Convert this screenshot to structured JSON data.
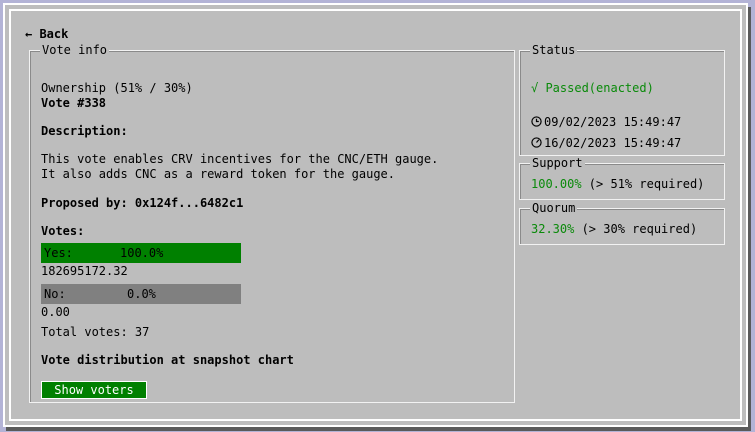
{
  "nav": {
    "back_label": "← Back"
  },
  "vote_info": {
    "legend": "Vote info",
    "ownership": "Ownership (51% / 30%)",
    "vote_number": "Vote #338",
    "description_heading": "Description:",
    "description_lines": [
      "This vote enables CRV incentives for the CNC/ETH gauge.",
      "It also adds CNC as a reward token for the gauge."
    ],
    "proposed_by": "Proposed by: 0x124f...6482c1",
    "votes_heading": "Votes:",
    "yes": {
      "label": "Yes:",
      "percent_text": "100.0%",
      "fill": 1.0,
      "amount": "182695172.32"
    },
    "no": {
      "label": "No:",
      "percent_text": "0.0%",
      "fill": 0.0,
      "amount": "0.00"
    },
    "total_votes": "Total votes: 37",
    "distribution_heading": "Vote distribution at snapshot chart",
    "show_voters_label": "Show voters"
  },
  "status": {
    "legend": "Status",
    "state": "√ Passed(enacted)",
    "start_time": "09/02/2023 15:49:47",
    "end_time": "16/02/2023 15:49:47",
    "start_icon": "clock-icon",
    "end_icon": "clock-end-icon"
  },
  "support": {
    "legend": "Support",
    "value": "100.00%",
    "requirement": " (> 51% required)"
  },
  "quorum": {
    "legend": "Quorum",
    "value": "32.30%",
    "requirement": " (> 30% required)"
  },
  "colors": {
    "accent_green": "#008000",
    "text_green": "#0a8a0a",
    "bar_no": "#808080",
    "window_bg": "#bdbdbd"
  }
}
